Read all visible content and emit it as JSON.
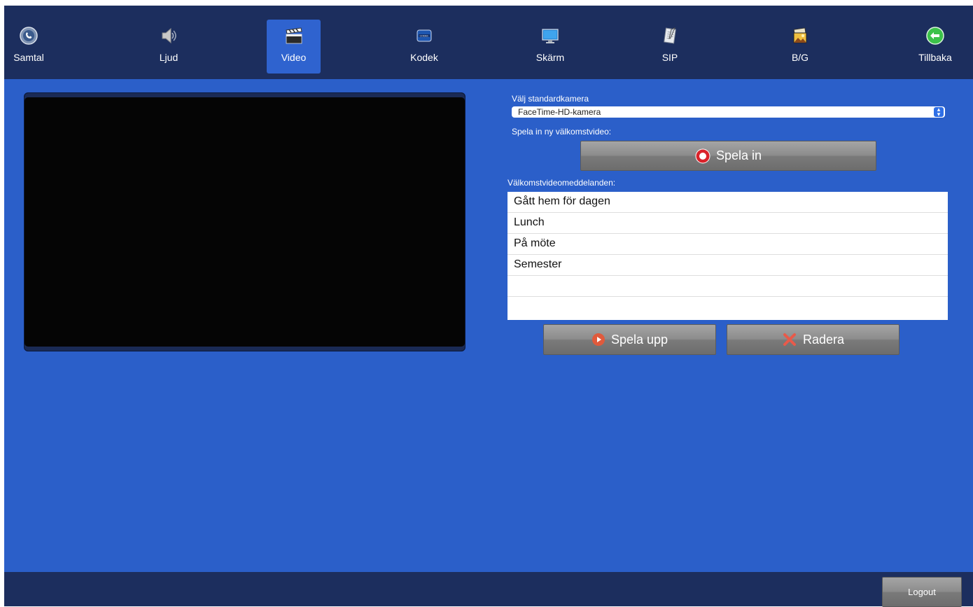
{
  "toolbar": {
    "items": [
      {
        "label": "Samtal",
        "icon": "phone-icon"
      },
      {
        "label": "Ljud",
        "icon": "speaker-icon"
      },
      {
        "label": "Video",
        "icon": "clapperboard-icon"
      },
      {
        "label": "Kodek",
        "icon": "codec-icon"
      },
      {
        "label": "Skärm",
        "icon": "monitor-icon"
      },
      {
        "label": "SIP",
        "icon": "document-icon"
      },
      {
        "label": "B/G",
        "icon": "picture-icon"
      },
      {
        "label": "Tillbaka",
        "icon": "back-arrow-icon"
      }
    ],
    "active": "Video"
  },
  "camera": {
    "label": "Välj standardkamera",
    "selected": "FaceTime-HD-kamera"
  },
  "record": {
    "label": "Spela in ny välkomstvideo:",
    "button": "Spela in"
  },
  "messages": {
    "label": "Välkomstvideomeddelanden:",
    "items": [
      "Gått hem för dagen",
      "Lunch",
      "På möte",
      "Semester",
      "",
      ""
    ]
  },
  "actions": {
    "play": "Spela upp",
    "delete": "Radera"
  },
  "footer": {
    "logout": "Logout"
  },
  "colors": {
    "background": "#2b5fc9",
    "toolbar": "#1c2e5e",
    "active_tab": "#2f63cf",
    "record_red": "#d9222a"
  }
}
